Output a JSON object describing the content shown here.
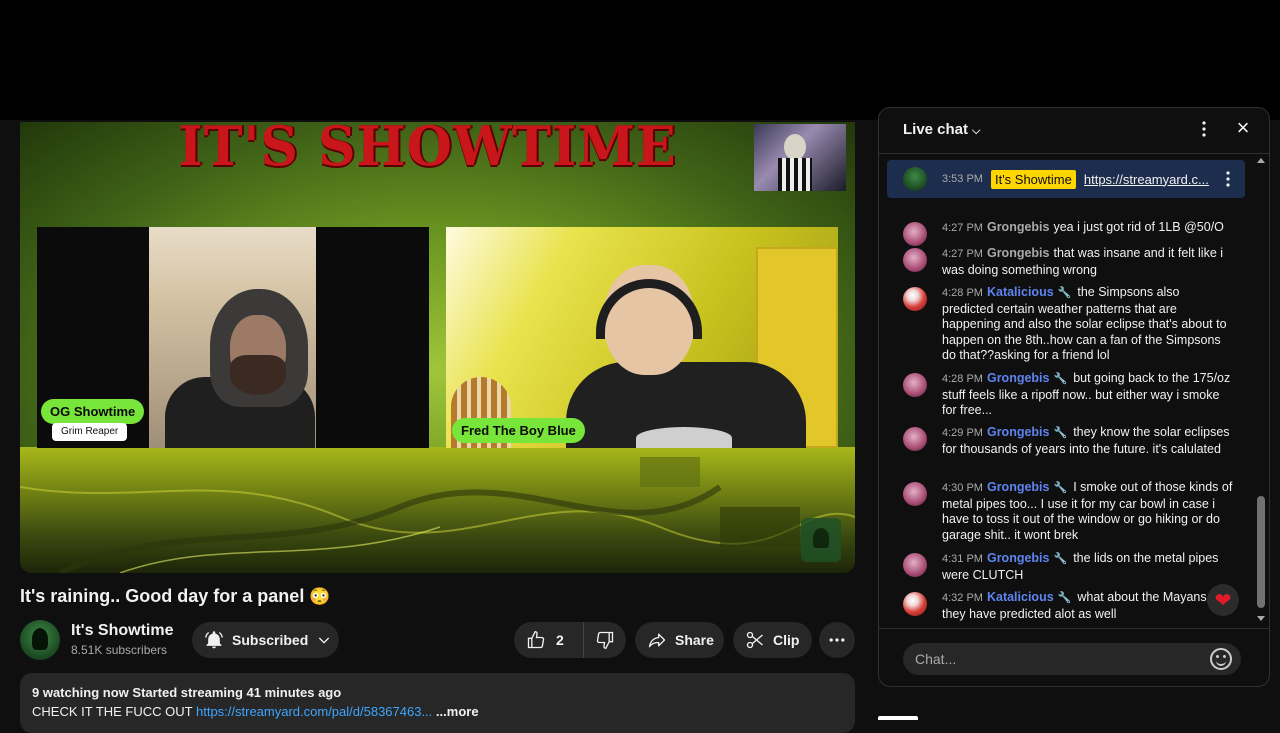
{
  "video": {
    "banner": "IT'S SHOWTIME",
    "guest1_name": "OG Showtime",
    "guest1_subtitle": "Grim Reaper",
    "guest2_name": "Fred The Boy Blue"
  },
  "title": "It's raining.. Good day for a panel",
  "title_emoji": "😳",
  "channel": {
    "name": "It's Showtime",
    "subscribers": "8.51K subscribers",
    "subscribe_label": "Subscribed"
  },
  "actions": {
    "like_count": "2",
    "share_label": "Share",
    "clip_label": "Clip"
  },
  "description": {
    "stats": "9 watching now  Started streaming 41 minutes ago",
    "text": "CHECK IT THE FUCC OUT",
    "link": "https://streamyard.com/pal/d/58367463...",
    "more": "...more"
  },
  "chat": {
    "title": "Live chat",
    "pinned": {
      "time": "3:53 PM",
      "author": "It's Showtime",
      "text": "https://streamyard.c..."
    },
    "messages": [
      {
        "time": "4:27 PM",
        "author": "Grongebis",
        "mod": false,
        "text": "yea i just got rid of 1LB @50/O"
      },
      {
        "time": "4:27 PM",
        "author": "Grongebis",
        "mod": false,
        "text": "that was insane and it felt like i was doing something wrong"
      },
      {
        "time": "4:28 PM",
        "author": "Katalicious",
        "mod": true,
        "text": "the Simpsons also predicted certain weather patterns that are happening and also the solar eclipse that's about to happen on the 8th..how can a fan of the Simpsons do that??asking for a friend lol"
      },
      {
        "time": "4:28 PM",
        "author": "Grongebis",
        "mod": true,
        "text": "but going back to the 175/oz stuff feels like a ripoff now.. but either way i smoke for free..."
      },
      {
        "time": "4:29 PM",
        "author": "Grongebis",
        "mod": true,
        "text": "they know the solar eclipses for thousands of years into the future. it's calulated"
      },
      {
        "time": "4:30 PM",
        "author": "Grongebis",
        "mod": true,
        "text": "I smoke out of those kinds of metal pipes too... I use it for my car bowl in case i have to toss it out of the window or go hiking or do garage shit.. it wont brek"
      },
      {
        "time": "4:31 PM",
        "author": "Grongebis",
        "mod": true,
        "text": "the lids on the metal pipes were CLUTCH"
      },
      {
        "time": "4:32 PM",
        "author": "Katalicious",
        "mod": true,
        "text": "what about the Mayans they have predicted alot as well"
      }
    ],
    "input_placeholder": "Chat..."
  },
  "colors": {
    "accent_link": "#3ea6ff",
    "moderator_name": "#5e84f1",
    "owner_badge": "#ffd600",
    "name_tag": "#78e53b",
    "banner_red": "#c8161b"
  }
}
